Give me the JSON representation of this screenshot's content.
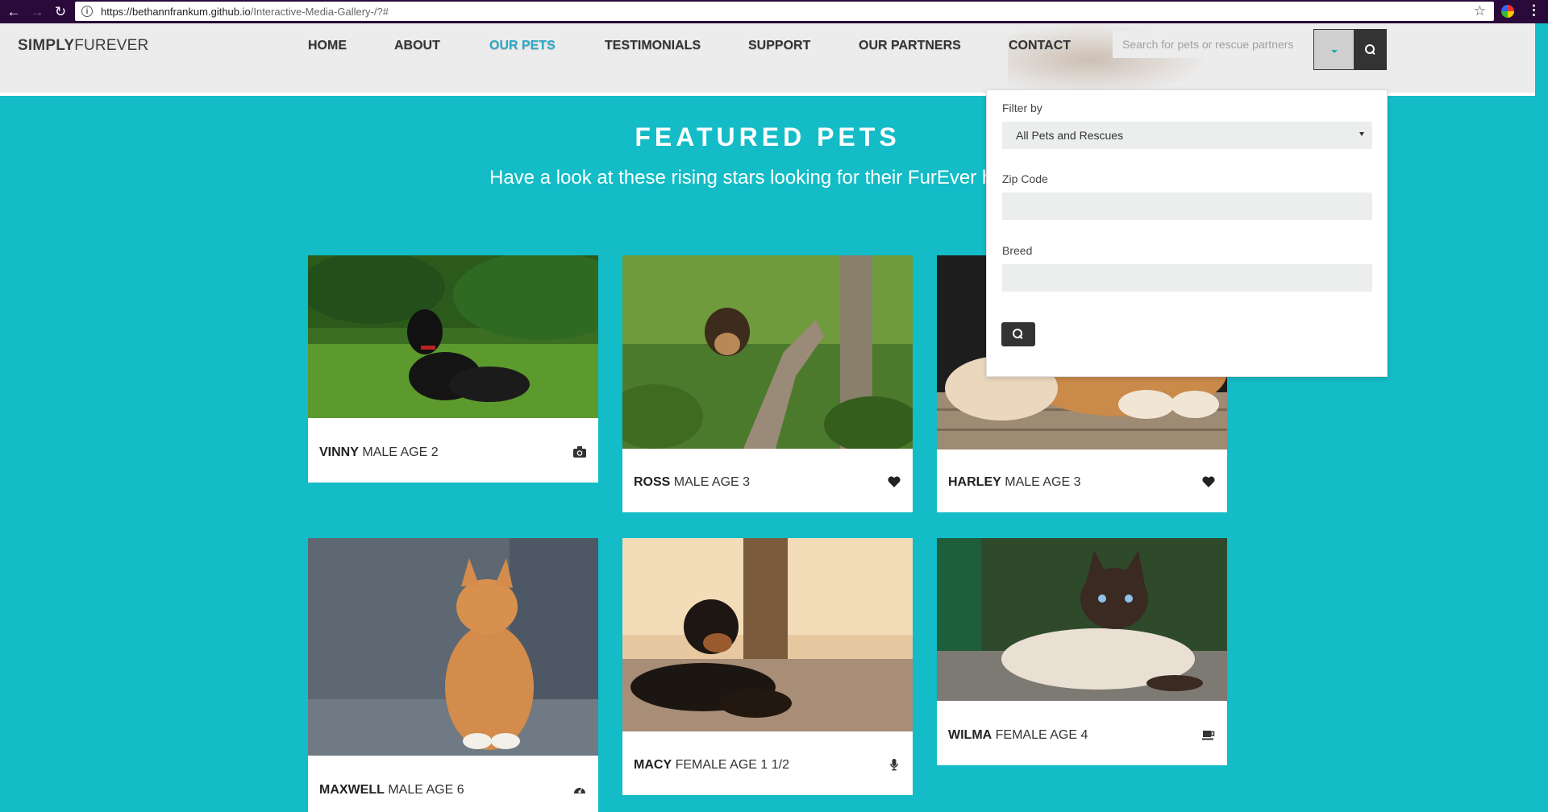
{
  "browser": {
    "url_host": "https://bethannfrankum.github.io",
    "url_path": "/Interactive-Media-Gallery-/?#"
  },
  "site": {
    "logo_bold": "SIMPLY",
    "logo_light": "FUREVER"
  },
  "nav": [
    {
      "label": "HOME"
    },
    {
      "label": "ABOUT"
    },
    {
      "label": "OUR PETS",
      "active": true
    },
    {
      "label": "TESTIMONIALS"
    },
    {
      "label": "SUPPORT"
    },
    {
      "label": "OUR PARTNERS"
    },
    {
      "label": "CONTACT"
    }
  ],
  "search": {
    "placeholder": "Search for pets or rescue partners"
  },
  "featured": {
    "title": "FEATURED PETS",
    "subtitle": "Have a look at these rising stars looking for their FurEver home"
  },
  "pets": [
    {
      "name": "VINNY",
      "details": "MALE AGE 2",
      "icon": "camera-icon"
    },
    {
      "name": "ROSS",
      "details": "MALE AGE 3",
      "icon": "heart-icon"
    },
    {
      "name": "HARLEY",
      "details": "MALE AGE 3",
      "icon": "heart-icon"
    },
    {
      "name": "MAXWELL",
      "details": "MALE AGE 6",
      "icon": "dashboard-icon"
    },
    {
      "name": "MACY",
      "details": "FEMALE AGE 1 1/2",
      "icon": "microphone-icon"
    },
    {
      "name": "WILMA",
      "details": "FEMALE AGE 4",
      "icon": "coffee-cup-icon"
    }
  ],
  "filter": {
    "filter_label": "Filter by",
    "filter_value": "All Pets and Rescues",
    "zip_label": "Zip Code",
    "zip_value": "",
    "breed_label": "Breed",
    "breed_value": ""
  },
  "colors": {
    "accent": "#2aa9c5",
    "background": "#13bcc6"
  }
}
